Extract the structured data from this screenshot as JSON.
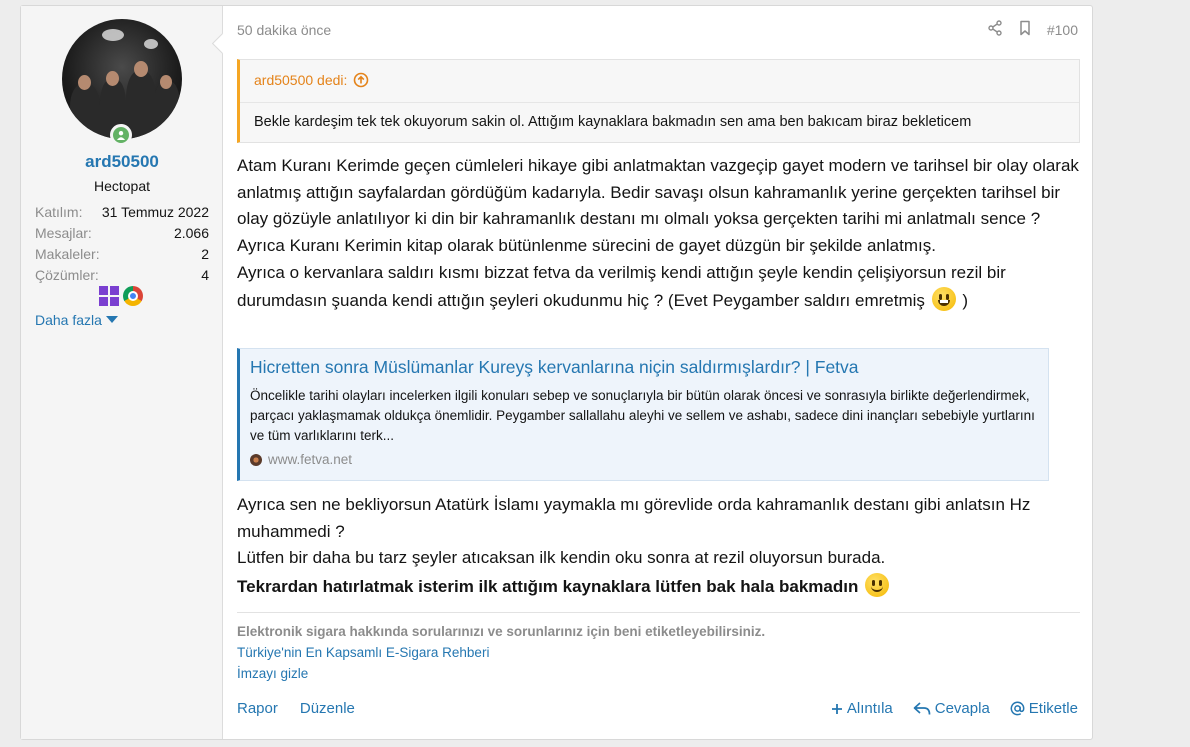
{
  "post": {
    "time": "50 dakika önce",
    "number": "#100",
    "icons": {
      "share": "share-icon",
      "bookmark": "bookmark-icon"
    }
  },
  "user": {
    "name": "ard50500",
    "title": "Hectopat",
    "stats": [
      {
        "key": "Katılım:",
        "value": "31 Temmuz 2022"
      },
      {
        "key": "Mesajlar:",
        "value": "2.066"
      },
      {
        "key": "Makaleler:",
        "value": "2"
      },
      {
        "key": "Çözümler:",
        "value": "4"
      }
    ],
    "more": "Daha fazla",
    "badges": [
      "windows-icon",
      "chrome-icon"
    ]
  },
  "quote": {
    "author": "ard50500 dedi:",
    "text": "Bekle kardeşim tek tek okuyorum sakin ol. Attığım kaynaklara bakmadın sen ama ben bakıcam biraz bekleticem"
  },
  "body": {
    "p1": "Atam Kuranı Kerimde geçen cümleleri hikaye gibi anlatmaktan vazgeçip gayet modern ve tarihsel bir olay olarak anlatmış attığın sayfalardan gördüğüm kadarıyla. Bedir savaşı olsun kahramanlık yerine gerçekten tarihsel bir olay gözüyle anlatılıyor ki din bir kahramanlık destanı mı olmalı yoksa gerçekten tarihi mi anlatmalı sence ? Ayrıca Kuranı Kerimin kitap olarak bütünlenme sürecini de gayet düzgün bir şekilde anlatmış.",
    "p2": "Ayrıca o kervanlara saldırı kısmı bizzat fetva da verilmiş kendi attığın şeyle kendin çelişiyorsun rezil bir durumdasın şuanda kendi attığın şeyleri okudunmu hiç ? (Evet Peygamber saldırı emretmiş",
    "p2_end": ")",
    "p3": "Ayrıca sen ne bekliyorsun Atatürk İslamı yaymakla mı görevlide orda kahramanlık destanı gibi anlatsın Hz muhammedi ?",
    "p4": "Lütfen bir daha bu tarz şeyler atıcaksan ilk kendin oku sonra at rezil oluyorsun burada.",
    "p5": "Tekrardan hatırlatmak isterim ilk attığım kaynaklara lütfen bak hala bakmadın"
  },
  "unfurl": {
    "title": "Hicretten sonra Müslümanlar Kureyş kervanlarına niçin saldırmışlardır? | Fetva",
    "description": "Öncelikle tarihi olayları incelerken ilgili konuları sebep ve sonuçlarıyla bir bütün olarak öncesi ve sonrasıyla birlikte değerlendirmek, parçacı yaklaşmamak oldukça önemlidir. Peygamber sallallahu aleyhi ve sellem ve ashabı, sadece dini inançları sebebiyle yurtlarını ve tüm varlıklarını terk...",
    "domain": "www.fetva.net"
  },
  "signature": {
    "line1": "Elektronik sigara hakkında sorularınızı ve sorunlarınız için beni etiketleyebilirsiniz.",
    "line2": "Türkiye'nin En Kapsamlı E-Sigara Rehberi",
    "line3": "İmzayı gizle"
  },
  "footer": {
    "report": "Rapor",
    "edit": "Düzenle",
    "quote": "Alıntıla",
    "reply": "Cevapla",
    "tag": "Etiketle"
  }
}
